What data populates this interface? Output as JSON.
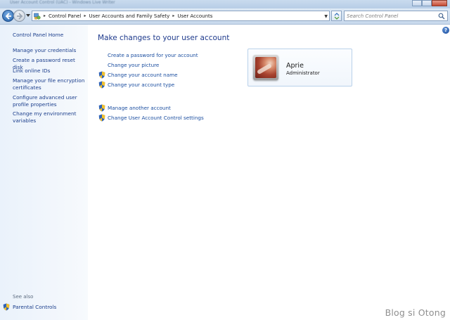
{
  "window": {
    "title": "User Account Control (UAC) - Windows Live Writer"
  },
  "navbar": {
    "breadcrumbs": [
      "Control Panel",
      "User Accounts and Family Safety",
      "User Accounts"
    ],
    "search_placeholder": "Search Control Panel"
  },
  "sidebar": {
    "home": "Control Panel Home",
    "links": [
      "Manage your credentials",
      "Create a password reset disk",
      "Link online IDs",
      "Manage your file encryption certificates",
      "Configure advanced user profile properties",
      "Change my environment variables"
    ],
    "see_also_label": "See also",
    "see_also_links": [
      "Parental Controls"
    ]
  },
  "main": {
    "title": "Make changes to your user account",
    "tasks": [
      {
        "label": "Create a password for your account",
        "shield": false
      },
      {
        "label": "Change your picture",
        "shield": false
      },
      {
        "label": "Change your account name",
        "shield": true
      },
      {
        "label": "Change your account type",
        "shield": true
      }
    ],
    "other_tasks": [
      {
        "label": "Manage another account",
        "shield": true
      },
      {
        "label": "Change User Account Control settings",
        "shield": true
      }
    ],
    "user": {
      "name": "Aprie",
      "role": "Administrator"
    }
  },
  "watermark": "Blog si Otong",
  "colors": {
    "link": "#1b4ea0",
    "title": "#1e3a8c",
    "sidebar_bg": "#eaf2fb",
    "navbar_bg": "#c8d9ec"
  }
}
